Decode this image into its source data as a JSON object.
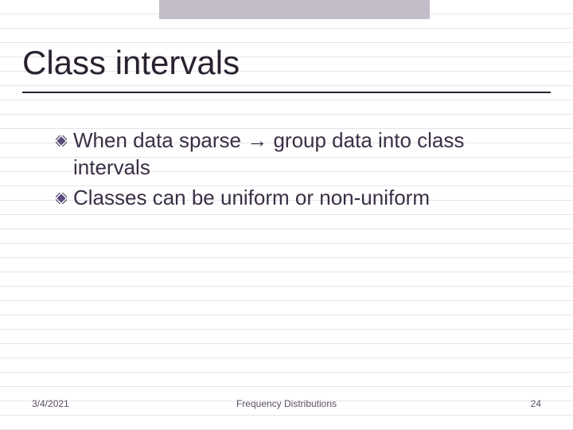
{
  "slide": {
    "title": "Class intervals",
    "bullets": [
      "When data sparse → group data into class intervals",
      "Classes can be uniform or non-uniform"
    ]
  },
  "footer": {
    "date": "3/4/2021",
    "title": "Frequency Distributions",
    "page": "24"
  },
  "colors": {
    "accent": "#4a3a6a",
    "text": "#3a2f45"
  }
}
